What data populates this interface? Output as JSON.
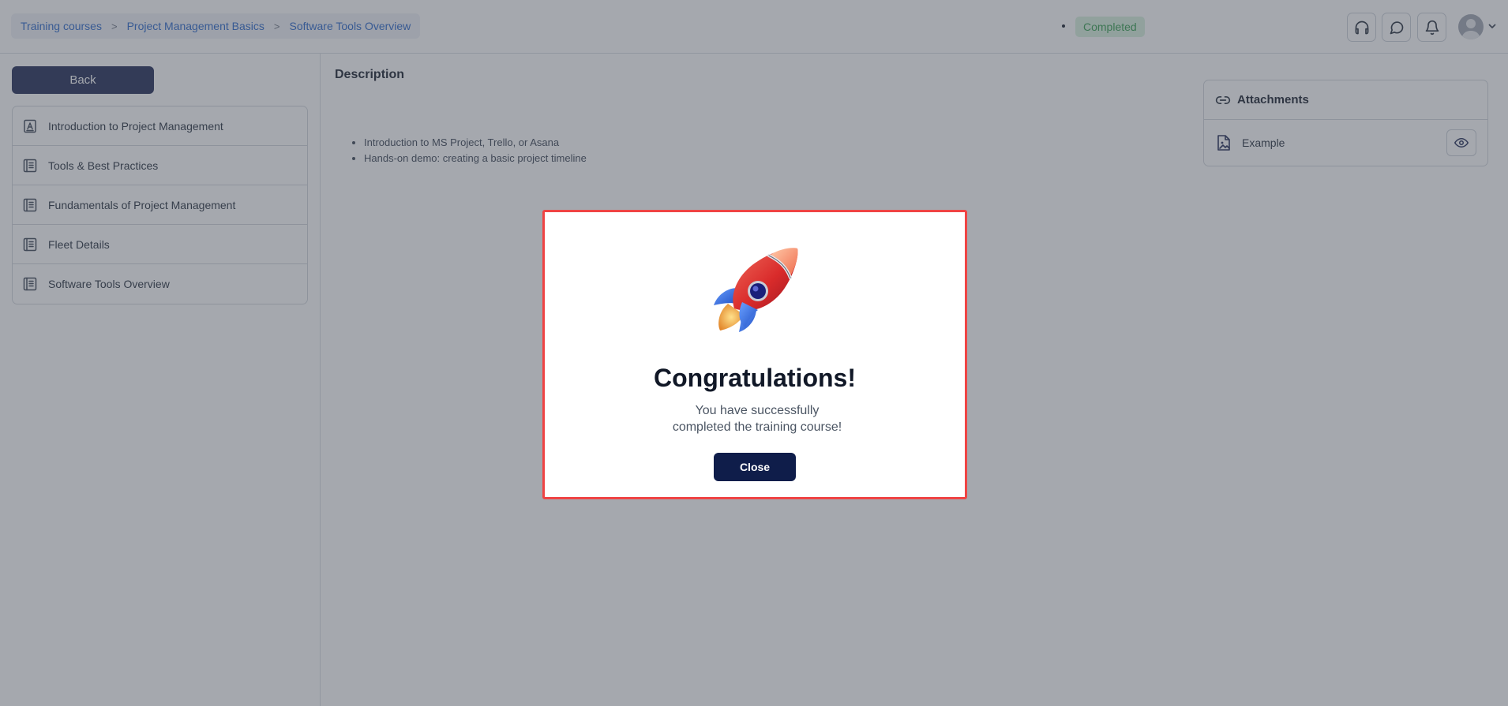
{
  "header": {
    "breadcrumbs": [
      "Training courses",
      "Project Management Basics",
      "Software Tools Overview"
    ],
    "breadcrumb_separator": ">",
    "status": "Completed",
    "icons": [
      "headset-icon",
      "chat-icon",
      "bell-icon",
      "avatar",
      "chevron-down-icon"
    ]
  },
  "sidebar": {
    "back_label": "Back",
    "lessons": [
      {
        "label": "Introduction to Project Management",
        "icon": "text-file-icon"
      },
      {
        "label": "Tools & Best Practices",
        "icon": "document-icon"
      },
      {
        "label": "Fundamentals of Project Management",
        "icon": "document-icon"
      },
      {
        "label": "Fleet Details",
        "icon": "document-icon"
      },
      {
        "label": "Software Tools Overview",
        "icon": "document-icon"
      }
    ]
  },
  "main": {
    "description_title": "Description",
    "bullets": [
      "Introduction to MS Project, Trello, or Asana",
      "Hands-on demo: creating a basic project timeline"
    ]
  },
  "attachments": {
    "title": "Attachments",
    "items": [
      {
        "name": "Example",
        "icon": "image-file-icon"
      }
    ]
  },
  "modal": {
    "title": "Congratulations!",
    "message_line1": "You have successfully",
    "message_line2": "completed the training course!",
    "close_label": "Close",
    "icon": "rocket-icon"
  },
  "colors": {
    "primary": "#1a2550",
    "link": "#2563c9",
    "success_text": "#2f9a4b",
    "success_bg": "#d7f1dc",
    "modal_border": "#ef4444"
  }
}
